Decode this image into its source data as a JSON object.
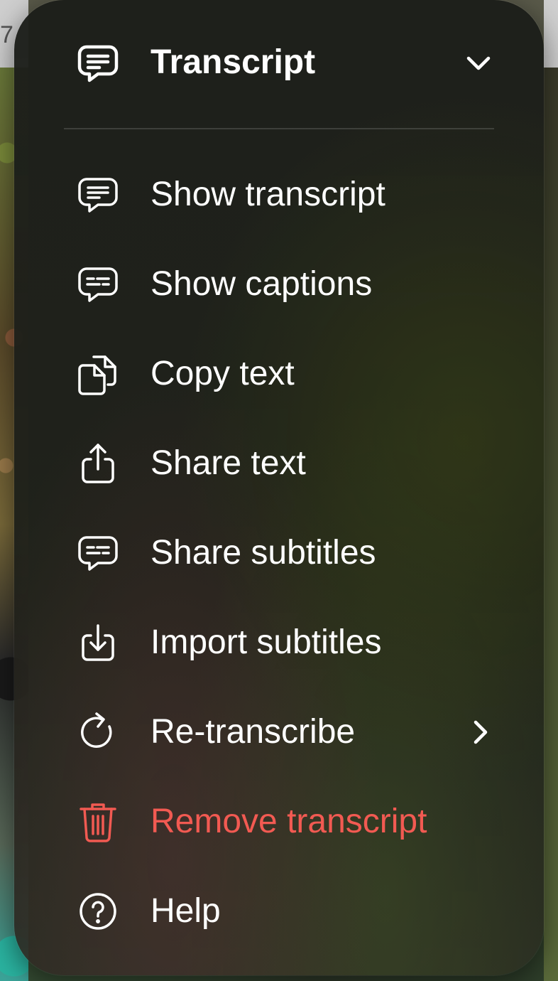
{
  "background": {
    "partial_number": "7"
  },
  "menu": {
    "header": {
      "title": "Transcript",
      "icon": "transcript-bubble-icon",
      "chevron": "chevron-down-icon"
    },
    "items": [
      {
        "label": "Show transcript",
        "icon": "transcript-bubble-icon"
      },
      {
        "label": "Show captions",
        "icon": "captions-bubble-icon"
      },
      {
        "label": "Copy text",
        "icon": "copy-documents-icon"
      },
      {
        "label": "Share text",
        "icon": "share-icon"
      },
      {
        "label": "Share subtitles",
        "icon": "captions-bubble-icon"
      },
      {
        "label": "Import subtitles",
        "icon": "import-icon"
      },
      {
        "label": "Re-transcribe",
        "icon": "refresh-icon",
        "has_submenu": true
      },
      {
        "label": "Remove transcript",
        "icon": "trash-icon",
        "destructive": true
      },
      {
        "label": "Help",
        "icon": "help-circle-icon"
      }
    ]
  },
  "colors": {
    "text": "#ffffff",
    "destructive": "#f25a52",
    "menu_background": "#1e201a"
  }
}
